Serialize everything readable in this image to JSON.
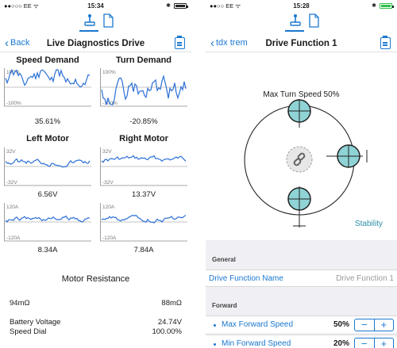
{
  "left": {
    "status": {
      "carrier": "●●○○○ EE ᯤ",
      "time": "15:34",
      "bluetooth": "✱"
    },
    "nav": {
      "back_label": "Back",
      "title": "Live Diagnostics Drive"
    },
    "graphs": {
      "speed_demand": {
        "title": "Speed Demand",
        "top_label": "100%",
        "bottom_label": "-100%",
        "value": "35.61%"
      },
      "turn_demand": {
        "title": "Turn Demand",
        "top_label": "100%",
        "bottom_label": "-100%",
        "value": "-20.85%"
      },
      "left_motor_v": {
        "title": "Left Motor",
        "top_label": "32V",
        "bottom_label": "-32V",
        "value": "6.56V"
      },
      "right_motor_v": {
        "title": "Right Motor",
        "top_label": "32V",
        "bottom_label": "-32V",
        "value": "13.37V"
      },
      "left_motor_a": {
        "top_label": "120A",
        "bottom_label": "-120A",
        "value": "8.34A"
      },
      "right_motor_a": {
        "top_label": "120A",
        "bottom_label": "-120A",
        "value": "7.84A"
      }
    },
    "motor_resistance": {
      "title": "Motor Resistance",
      "left": "94mΩ",
      "right": "88mΩ"
    },
    "battery": {
      "label1": "Battery Voltage",
      "label2": "Speed Dial",
      "value1": "24.74V",
      "value2": "100.00%"
    }
  },
  "right": {
    "status": {
      "carrier": "●●○○ EE ᯤ",
      "time": "15:28",
      "bluetooth": "✱"
    },
    "nav": {
      "back_label": "tdx trem",
      "title": "Drive Function 1"
    },
    "turn_speed_label": "Max Turn Speed 50%",
    "stability_label": "Stability",
    "general_header": "General",
    "drive_function_name_label": "Drive Function Name",
    "drive_function_name_value": "Drive Function 1",
    "forward_header": "Forward",
    "max_forward_speed_label": "Max Forward Speed",
    "max_forward_speed_value": "50%",
    "next_row_label": "Min Forward Speed",
    "next_row_value": "20%"
  },
  "icons": {
    "tab_drive": "joystick-icon",
    "tab_doc": "document-icon",
    "clipboard": "clipboard-icon",
    "link": "link-icon",
    "battery": "battery-icon"
  },
  "colors": {
    "accent": "#1a78d0",
    "trace": "#2b6fd6",
    "handle": "#8fd3d6",
    "stability": "#2a8fa8"
  }
}
